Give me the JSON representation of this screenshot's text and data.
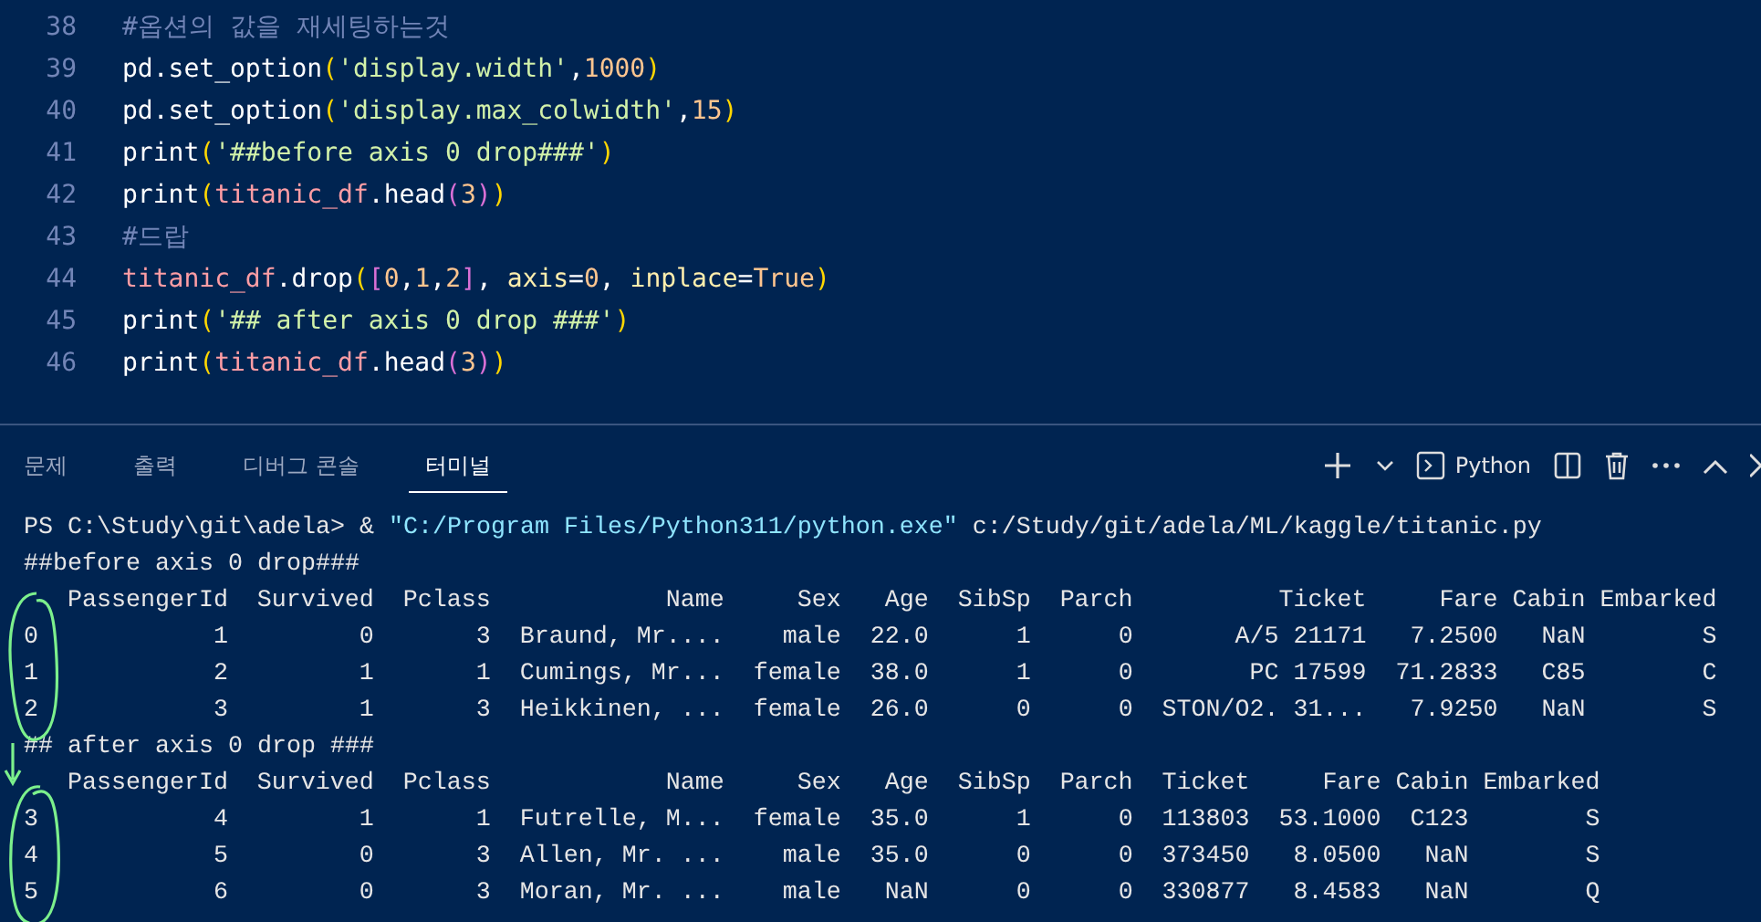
{
  "editor": {
    "lines": [
      {
        "number": "38",
        "tokens": [
          {
            "text": "#옵션의 값을 재세팅하는것",
            "kind": "comment"
          }
        ]
      },
      {
        "number": "39",
        "tokens": [
          {
            "text": "pd.set_option",
            "kind": "plain"
          },
          {
            "text": "(",
            "kind": "bracket1"
          },
          {
            "text": "'display.width'",
            "kind": "string"
          },
          {
            "text": ",",
            "kind": "plain"
          },
          {
            "text": "1000",
            "kind": "number"
          },
          {
            "text": ")",
            "kind": "bracket1"
          }
        ]
      },
      {
        "number": "40",
        "tokens": [
          {
            "text": "pd.set_option",
            "kind": "plain"
          },
          {
            "text": "(",
            "kind": "bracket1"
          },
          {
            "text": "'display.max_colwidth'",
            "kind": "string"
          },
          {
            "text": ",",
            "kind": "plain"
          },
          {
            "text": "15",
            "kind": "number"
          },
          {
            "text": ")",
            "kind": "bracket1"
          }
        ]
      },
      {
        "number": "41",
        "tokens": [
          {
            "text": "print",
            "kind": "plain"
          },
          {
            "text": "(",
            "kind": "bracket1"
          },
          {
            "text": "'##before axis 0 drop###'",
            "kind": "string"
          },
          {
            "text": ")",
            "kind": "bracket1"
          }
        ]
      },
      {
        "number": "42",
        "tokens": [
          {
            "text": "print",
            "kind": "plain"
          },
          {
            "text": "(",
            "kind": "bracket1"
          },
          {
            "text": "titanic_df",
            "kind": "variable"
          },
          {
            "text": ".head",
            "kind": "plain"
          },
          {
            "text": "(",
            "kind": "bracket2"
          },
          {
            "text": "3",
            "kind": "number"
          },
          {
            "text": ")",
            "kind": "bracket2"
          },
          {
            "text": ")",
            "kind": "bracket1"
          }
        ]
      },
      {
        "number": "43",
        "tokens": [
          {
            "text": "#드랍",
            "kind": "comment"
          }
        ]
      },
      {
        "number": "44",
        "tokens": [
          {
            "text": "titanic_df",
            "kind": "variable"
          },
          {
            "text": ".drop",
            "kind": "plain"
          },
          {
            "text": "(",
            "kind": "bracket1"
          },
          {
            "text": "[",
            "kind": "bracket2"
          },
          {
            "text": "0",
            "kind": "number"
          },
          {
            "text": ",",
            "kind": "plain"
          },
          {
            "text": "1",
            "kind": "number"
          },
          {
            "text": ",",
            "kind": "plain"
          },
          {
            "text": "2",
            "kind": "number"
          },
          {
            "text": "]",
            "kind": "bracket2"
          },
          {
            "text": ", ",
            "kind": "plain"
          },
          {
            "text": "axis",
            "kind": "param"
          },
          {
            "text": "=",
            "kind": "plain"
          },
          {
            "text": "0",
            "kind": "number"
          },
          {
            "text": ", ",
            "kind": "plain"
          },
          {
            "text": "inplace",
            "kind": "param"
          },
          {
            "text": "=",
            "kind": "plain"
          },
          {
            "text": "True",
            "kind": "number"
          },
          {
            "text": ")",
            "kind": "bracket1"
          }
        ]
      },
      {
        "number": "45",
        "tokens": [
          {
            "text": "print",
            "kind": "plain"
          },
          {
            "text": "(",
            "kind": "bracket1"
          },
          {
            "text": "'## after axis 0 drop ###'",
            "kind": "string"
          },
          {
            "text": ")",
            "kind": "bracket1"
          }
        ]
      },
      {
        "number": "46",
        "tokens": [
          {
            "text": "print",
            "kind": "plain"
          },
          {
            "text": "(",
            "kind": "bracket1"
          },
          {
            "text": "titanic_df",
            "kind": "variable"
          },
          {
            "text": ".head",
            "kind": "plain"
          },
          {
            "text": "(",
            "kind": "bracket2"
          },
          {
            "text": "3",
            "kind": "number"
          },
          {
            "text": ")",
            "kind": "bracket2"
          },
          {
            "text": ")",
            "kind": "bracket1"
          }
        ]
      }
    ]
  },
  "panel": {
    "tabs": [
      {
        "label": "문제",
        "selected": false
      },
      {
        "label": "출력",
        "selected": false
      },
      {
        "label": "디버그 콘솔",
        "selected": false
      },
      {
        "label": "터미널",
        "selected": true
      }
    ],
    "shell_label": "Python"
  },
  "terminal": {
    "outputs": [
      {
        "kind": "command",
        "tokens": [
          {
            "text": "PS C:\\Study\\git\\adela> & ",
            "kind": "plain"
          },
          {
            "text": "\"C:/Program Files/Python311/python.exe\"",
            "kind": "string"
          },
          {
            "text": " c:/Study/git/adela/ML/kaggle/titanic.py",
            "kind": "plain"
          }
        ]
      },
      {
        "kind": "text",
        "text": "##before axis 0 drop###"
      },
      {
        "kind": "dataframe",
        "columns": [
          "PassengerId",
          "Survived",
          "Pclass",
          "Name",
          "Sex",
          "Age",
          "SibSp",
          "Parch",
          "Ticket",
          "Fare",
          "Cabin",
          "Embarked"
        ],
        "rows": [
          {
            "index": "0",
            "cells": [
              "1",
              "0",
              "3",
              "Braund, Mr....",
              "male",
              "22.0",
              "1",
              "0",
              "A/5 21171",
              "7.2500",
              "NaN",
              "S"
            ]
          },
          {
            "index": "1",
            "cells": [
              "2",
              "1",
              "1",
              "Cumings, Mr...",
              "female",
              "38.0",
              "1",
              "0",
              "PC 17599",
              "71.2833",
              "C85",
              "C"
            ]
          },
          {
            "index": "2",
            "cells": [
              "3",
              "1",
              "3",
              "Heikkinen, ...",
              "female",
              "26.0",
              "0",
              "0",
              "STON/O2. 31...",
              "7.9250",
              "NaN",
              "S"
            ]
          }
        ]
      },
      {
        "kind": "text",
        "text": "## after axis 0 drop ###"
      },
      {
        "kind": "dataframe",
        "columns": [
          "PassengerId",
          "Survived",
          "Pclass",
          "Name",
          "Sex",
          "Age",
          "SibSp",
          "Parch",
          "Ticket",
          "Fare",
          "Cabin",
          "Embarked"
        ],
        "rows": [
          {
            "index": "3",
            "cells": [
              "4",
              "1",
              "1",
              "Futrelle, M...",
              "female",
              "35.0",
              "1",
              "0",
              "113803",
              "53.1000",
              "C123",
              "S"
            ]
          },
          {
            "index": "4",
            "cells": [
              "5",
              "0",
              "3",
              "Allen, Mr. ...",
              "male",
              "35.0",
              "0",
              "0",
              "373450",
              "8.0500",
              "NaN",
              "S"
            ]
          },
          {
            "index": "5",
            "cells": [
              "6",
              "0",
              "3",
              "Moran, Mr. ...",
              "male",
              "NaN",
              "0",
              "0",
              "330877",
              "8.4583",
              "NaN",
              "Q"
            ]
          }
        ]
      }
    ]
  }
}
